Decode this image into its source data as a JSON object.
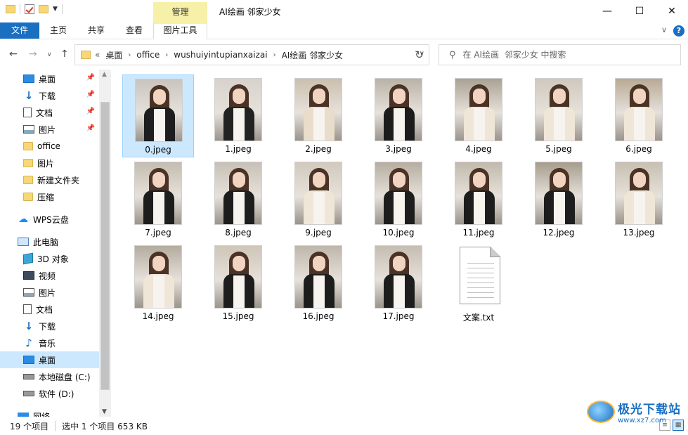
{
  "window": {
    "title": "AI绘画  邻家少女",
    "context_group": "管理",
    "controls": {
      "minimize": "—",
      "maximize": "☐",
      "close": "✕"
    }
  },
  "ribbon": {
    "tabs": [
      "文件",
      "主页",
      "共享",
      "查看",
      "图片工具"
    ],
    "expand_icon": "∨",
    "help_icon": "?"
  },
  "address": {
    "overflow": "«",
    "crumbs": [
      "桌面",
      "office",
      "wushuiyintupianxaizai",
      "AI绘画  邻家少女"
    ],
    "search_placeholder": "在 AI绘画  邻家少女 中搜索"
  },
  "sidebar": {
    "items": [
      {
        "label": "桌面",
        "icon": "desktop-icon",
        "pinned": true
      },
      {
        "label": "下载",
        "icon": "download-icon",
        "pinned": true
      },
      {
        "label": "文档",
        "icon": "document-icon",
        "pinned": true
      },
      {
        "label": "图片",
        "icon": "picture-icon",
        "pinned": true
      },
      {
        "label": "office",
        "icon": "folder-icon",
        "pinned": false
      },
      {
        "label": "图片",
        "icon": "folder-icon",
        "pinned": false
      },
      {
        "label": "新建文件夹",
        "icon": "folder-icon",
        "pinned": false
      },
      {
        "label": "压缩",
        "icon": "folder-icon",
        "pinned": false
      },
      {
        "label": "WPS云盘",
        "icon": "cloud-icon",
        "pinned": false
      },
      {
        "label": "此电脑",
        "icon": "computer-icon",
        "pinned": false
      },
      {
        "label": "3D 对象",
        "icon": "3d-objects-icon",
        "pinned": false
      },
      {
        "label": "视频",
        "icon": "video-icon",
        "pinned": false
      },
      {
        "label": "图片",
        "icon": "picture-icon",
        "pinned": false
      },
      {
        "label": "文档",
        "icon": "document-icon",
        "pinned": false
      },
      {
        "label": "下载",
        "icon": "download-icon",
        "pinned": false
      },
      {
        "label": "音乐",
        "icon": "music-icon",
        "pinned": false
      },
      {
        "label": "桌面",
        "icon": "desktop-icon",
        "pinned": false,
        "selected": true
      },
      {
        "label": "本地磁盘 (C:)",
        "icon": "local-disk-icon",
        "pinned": false
      },
      {
        "label": "软件 (D:)",
        "icon": "drive-icon",
        "pinned": false
      },
      {
        "label": "网络",
        "icon": "network-icon",
        "pinned": false
      }
    ]
  },
  "files": [
    {
      "name": "0.jpeg",
      "type": "image",
      "selected": true
    },
    {
      "name": "1.jpeg",
      "type": "image"
    },
    {
      "name": "2.jpeg",
      "type": "image"
    },
    {
      "name": "3.jpeg",
      "type": "image"
    },
    {
      "name": "4.jpeg",
      "type": "image"
    },
    {
      "name": "5.jpeg",
      "type": "image"
    },
    {
      "name": "6.jpeg",
      "type": "image"
    },
    {
      "name": "7.jpeg",
      "type": "image"
    },
    {
      "name": "8.jpeg",
      "type": "image"
    },
    {
      "name": "9.jpeg",
      "type": "image"
    },
    {
      "name": "10.jpeg",
      "type": "image"
    },
    {
      "name": "11.jpeg",
      "type": "image"
    },
    {
      "name": "12.jpeg",
      "type": "image"
    },
    {
      "name": "13.jpeg",
      "type": "image"
    },
    {
      "name": "14.jpeg",
      "type": "image"
    },
    {
      "name": "15.jpeg",
      "type": "image"
    },
    {
      "name": "16.jpeg",
      "type": "image"
    },
    {
      "name": "17.jpeg",
      "type": "image"
    },
    {
      "name": "文案.txt",
      "type": "text"
    }
  ],
  "status": {
    "item_count": "19 个项目",
    "selection": "选中 1 个项目  653 KB"
  },
  "watermark": {
    "name": "极光下载站",
    "url": "www.xz7.com"
  },
  "colors": {
    "accent": "#1a6fc1",
    "selection": "#cce8ff",
    "context_tab": "#f7f0a8",
    "folder": "#f8d775"
  }
}
